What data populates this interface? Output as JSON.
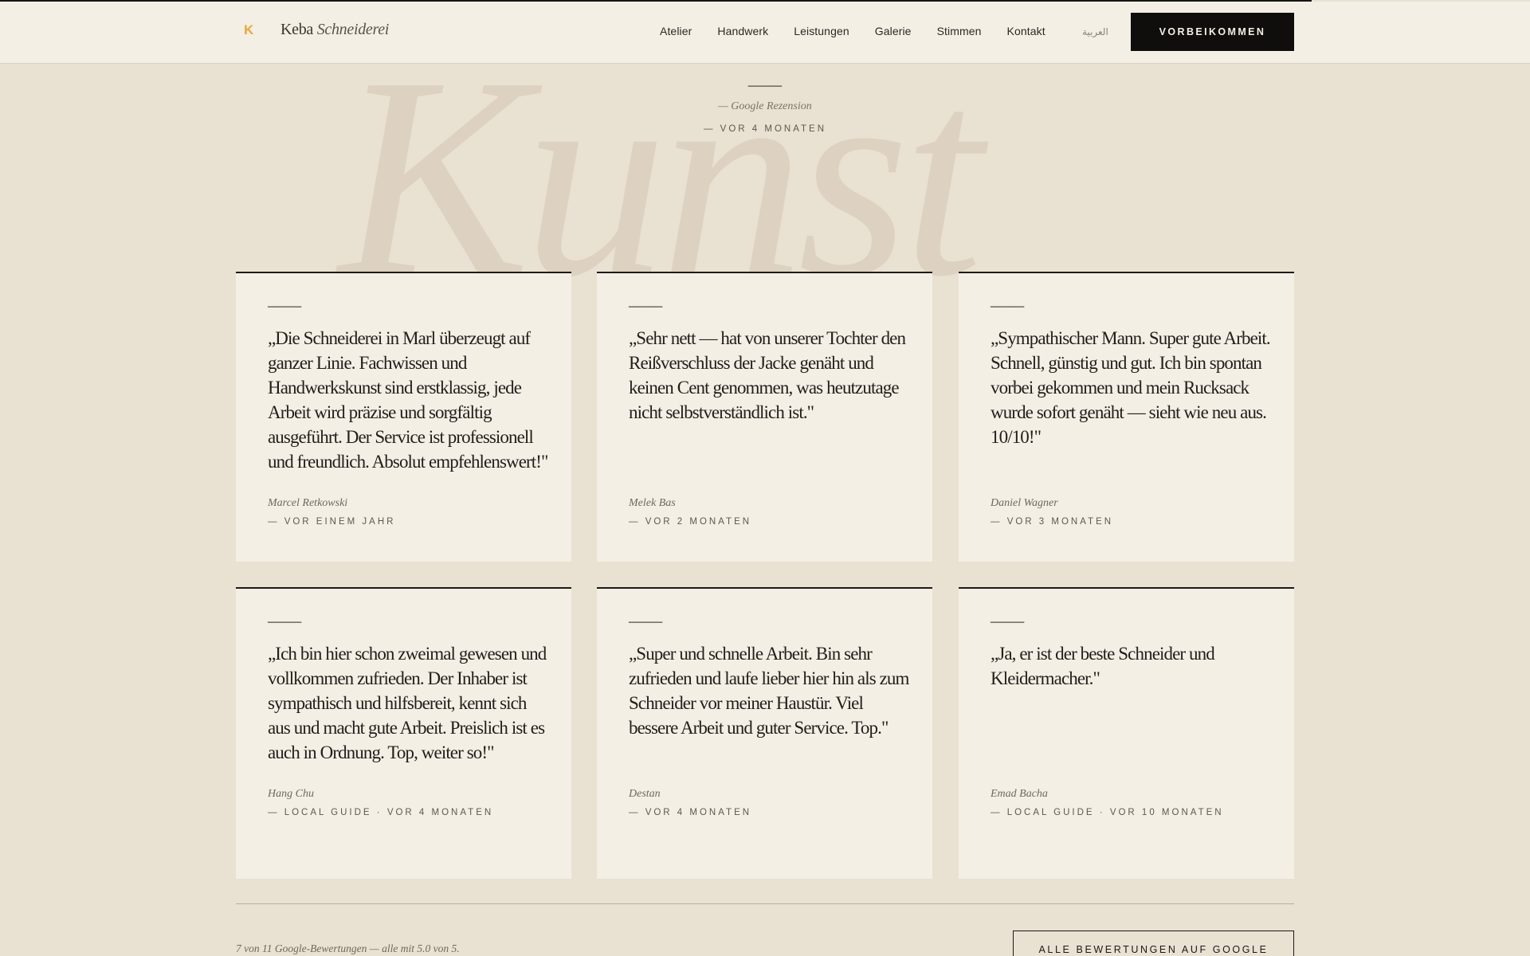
{
  "header": {
    "logo_mark": "K",
    "brand_first": "Keba",
    "brand_second": "Schneiderei",
    "nav": [
      "Atelier",
      "Handwerk",
      "Leistungen",
      "Galerie",
      "Stimmen",
      "Kontakt"
    ],
    "language": "العربية",
    "cta_label": "Vorbeikommen"
  },
  "watermark": "Kunst",
  "featured": {
    "rating_marks": "─────",
    "source": "— Google Rezension",
    "when": "— vor 4 Monaten"
  },
  "reviews": [
    {
      "rating_marks": "─────",
      "quote": "„Die Schneiderei in Marl überzeugt auf ganzer Linie. Fachwissen und Handwerkskunst sind erstklassig, jede Arbeit wird präzise und sorgfältig ausgeführt. Der Service ist professionell und freundlich. Absolut empfehlenswert!\"",
      "author": "Marcel Retkowski",
      "meta": "— vor einem Jahr"
    },
    {
      "rating_marks": "─────",
      "quote": "„Sehr nett — hat von unserer Tochter den Reißverschluss der Jacke genäht und keinen Cent genommen, was heutzutage nicht selbstverständlich ist.\"",
      "author": "Melek Bas",
      "meta": "— vor 2 Monaten"
    },
    {
      "rating_marks": "─────",
      "quote": "„Sympathischer Mann. Super gute Arbeit. Schnell, günstig und gut. Ich bin spontan vorbei gekommen und mein Rucksack wurde sofort genäht — sieht wie neu aus. 10/10!\"",
      "author": "Daniel Wagner",
      "meta": "— vor 3 Monaten"
    },
    {
      "rating_marks": "─────",
      "quote": "„Ich bin hier schon zweimal gewesen und vollkommen zufrieden. Der Inhaber ist sympathisch und hilfsbereit, kennt sich aus und macht gute Arbeit. Preislich ist es auch in Ordnung. Top, weiter so!\"",
      "author": "Hang Chu",
      "meta": "— Local Guide · vor 4 Monaten"
    },
    {
      "rating_marks": "─────",
      "quote": "„Super und schnelle Arbeit. Bin sehr zufrieden und laufe lieber hier hin als zum Schneider vor meiner Haustür. Viel bessere Arbeit und guter Service. Top.\"",
      "author": "Destan",
      "meta": "— vor 4 Monaten"
    },
    {
      "rating_marks": "─────",
      "quote": "„Ja, er ist der beste Schneider und Kleidermacher.\"",
      "author": "Emad Bacha",
      "meta": "— Local Guide · vor 10 Monaten"
    }
  ],
  "footer": {
    "note": "7 von 11 Google-Bewertungen — alle mit 5.0 von 5.",
    "all_reviews_label": "Alle Bewertungen auf Google"
  },
  "colors": {
    "background": "#e9e1d2",
    "card": "#f4efe5",
    "accent": "#e7a93c",
    "ink": "#1c1a17"
  }
}
